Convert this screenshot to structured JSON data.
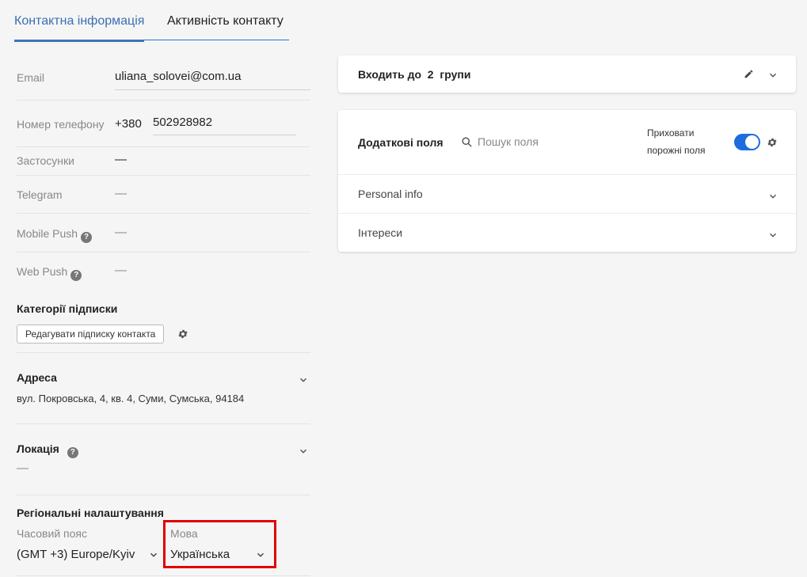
{
  "tabs": {
    "contact_info": "Контактна інформація",
    "contact_activity": "Активність контакту"
  },
  "fields": {
    "email_label": "Email",
    "email_value": "uliana_solovei@com.ua",
    "phone_label": "Номер телефону",
    "phone_code": "+380",
    "phone_number": "502928982",
    "apps_label": "Застосунки",
    "apps_value": "—",
    "telegram_label": "Telegram",
    "telegram_value": "—",
    "mobile_push_label": "Mobile Push",
    "mobile_push_value": "—",
    "web_push_label": "Web Push",
    "web_push_value": "—"
  },
  "subscription": {
    "title": "Категорії підписки",
    "edit_button": "Редагувати підписку контакта"
  },
  "address": {
    "title": "Адреса",
    "value": "вул. Покровська, 4, кв. 4, Суми, Сумська, 94184"
  },
  "location": {
    "title": "Локація",
    "value": "—"
  },
  "regional": {
    "title": "Регіональні налаштування",
    "timezone_label": "Часовий пояс",
    "timezone_value": "(GMT +3) Europe/Kyiv",
    "language_label": "Мова",
    "language_value": "Українська"
  },
  "groups_card": {
    "prefix": "Входить до",
    "count": "2",
    "suffix": "групи"
  },
  "extra_fields_card": {
    "title": "Додаткові поля",
    "search_placeholder": "Пошук поля",
    "hide_empty_line1": "Приховати",
    "hide_empty_line2": "порожні поля",
    "rows": [
      "Personal info",
      "Інтереси"
    ]
  },
  "colors": {
    "accent": "#1e6be0",
    "highlight": "#e00000"
  }
}
